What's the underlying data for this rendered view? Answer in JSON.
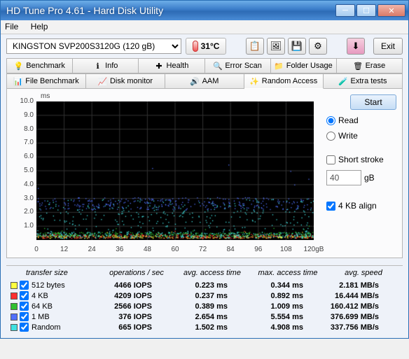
{
  "window": {
    "title": "HD Tune Pro 4.61 - Hard Disk Utility"
  },
  "menu": {
    "file": "File",
    "help": "Help"
  },
  "drive": {
    "selected": "KINGSTON SVP200S3120G (120 gB)"
  },
  "temp": {
    "value": "31°C"
  },
  "toolbar": {
    "exit": "Exit"
  },
  "tabs": {
    "row1": [
      {
        "icon": "💡",
        "label": "Benchmark"
      },
      {
        "icon": "ℹ",
        "label": "Info"
      },
      {
        "icon": "✚",
        "label": "Health"
      },
      {
        "icon": "🔍",
        "label": "Error Scan"
      },
      {
        "icon": "📁",
        "label": "Folder Usage"
      },
      {
        "icon": "🗑",
        "label": "Erase"
      }
    ],
    "row2": [
      {
        "icon": "📊",
        "label": "File Benchmark"
      },
      {
        "icon": "📈",
        "label": "Disk monitor"
      },
      {
        "icon": "🔊",
        "label": "AAM"
      },
      {
        "icon": "✨",
        "label": "Random Access",
        "sel": true
      },
      {
        "icon": "🧪",
        "label": "Extra tests"
      }
    ]
  },
  "controls": {
    "start": "Start",
    "read": "Read",
    "write": "Write",
    "short_stroke": "Short stroke",
    "stroke_val": "40",
    "stroke_unit": "gB",
    "align": "4 KB align"
  },
  "chart_data": {
    "type": "scatter",
    "title": "",
    "xlabel": "",
    "ylabel": "ms",
    "xlim": [
      0,
      120
    ],
    "ylim": [
      0,
      10
    ],
    "xticks": [
      0,
      12,
      24,
      36,
      48,
      60,
      72,
      84,
      96,
      108
    ],
    "xtick_last": "120gB",
    "yticks": [
      1.0,
      2.0,
      3.0,
      4.0,
      5.0,
      6.0,
      7.0,
      8.0,
      9.0,
      10.0
    ],
    "series": [
      {
        "name": "512 bytes",
        "color": "#ffff40",
        "avg_ms": 0.223,
        "band_ms": [
          0.15,
          0.35
        ]
      },
      {
        "name": "4 KB",
        "color": "#ff3030",
        "avg_ms": 0.237,
        "band_ms": [
          0.15,
          0.45
        ]
      },
      {
        "name": "64 KB",
        "color": "#30c030",
        "avg_ms": 0.389,
        "band_ms": [
          0.3,
          0.6
        ]
      },
      {
        "name": "1 MB",
        "color": "#5070ff",
        "avg_ms": 2.654,
        "band_ms": [
          2.2,
          3.1
        ]
      },
      {
        "name": "Random",
        "color": "#40e0e0",
        "avg_ms": 1.502,
        "band_ms": [
          0.2,
          3.0
        ]
      }
    ]
  },
  "results": {
    "headers": [
      "transfer size",
      "operations / sec",
      "avg. access time",
      "max. access time",
      "avg. speed"
    ],
    "rows": [
      {
        "color": "#ffff40",
        "label": "512 bytes",
        "ops": "4466 IOPS",
        "avg": "0.223 ms",
        "max": "0.344 ms",
        "speed": "2.181 MB/s"
      },
      {
        "color": "#ff3030",
        "label": "4 KB",
        "ops": "4209 IOPS",
        "avg": "0.237 ms",
        "max": "0.892 ms",
        "speed": "16.444 MB/s"
      },
      {
        "color": "#30c030",
        "label": "64 KB",
        "ops": "2566 IOPS",
        "avg": "0.389 ms",
        "max": "1.009 ms",
        "speed": "160.412 MB/s"
      },
      {
        "color": "#5070ff",
        "label": "1 MB",
        "ops": "376 IOPS",
        "avg": "2.654 ms",
        "max": "5.554 ms",
        "speed": "376.699 MB/s"
      },
      {
        "color": "#40e0e0",
        "label": "Random",
        "ops": "665 IOPS",
        "avg": "1.502 ms",
        "max": "4.908 ms",
        "speed": "337.756 MB/s"
      }
    ]
  }
}
